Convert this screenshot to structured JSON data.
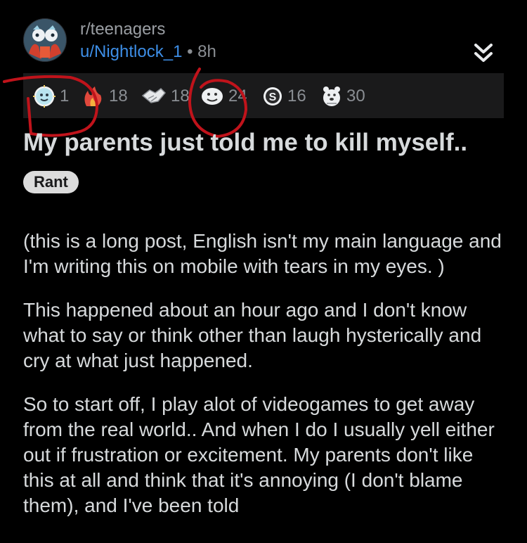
{
  "post": {
    "subreddit": "r/teenagers",
    "username": "u/Nightlock_1",
    "separator": "•",
    "time": "8h",
    "title": "My parents just told me to kill myself..",
    "flair": "Rant",
    "paragraphs": [
      "(this is a long post, English isn't my main language and I'm writing this on mobile with tears in my eyes. )",
      "This happened about an hour ago and I don't know what to say or think other than laugh hysterically and cry at what just happened.",
      "So to start off, I play alot of videogames to get away from the real world.. And when I do I usually yell either out if frustration or excitement. My parents don't like this at all and think that it's annoying (I don't blame them), and I've been told"
    ]
  },
  "awards": [
    {
      "icon": "sun-face-award-icon",
      "count": "1"
    },
    {
      "icon": "flame-award-icon",
      "count": "18"
    },
    {
      "icon": "handshake-award-icon",
      "count": "18"
    },
    {
      "icon": "face-award-icon",
      "count": "24"
    },
    {
      "icon": "s-coin-award-icon",
      "count": "16"
    },
    {
      "icon": "bear-award-icon",
      "count": "30"
    }
  ],
  "colors": {
    "background": "#000000",
    "award_bar": "#1a1a1b",
    "username": "#3d8ee6",
    "annotation": "#c0131b",
    "flair_bg": "#dcdcdc"
  }
}
